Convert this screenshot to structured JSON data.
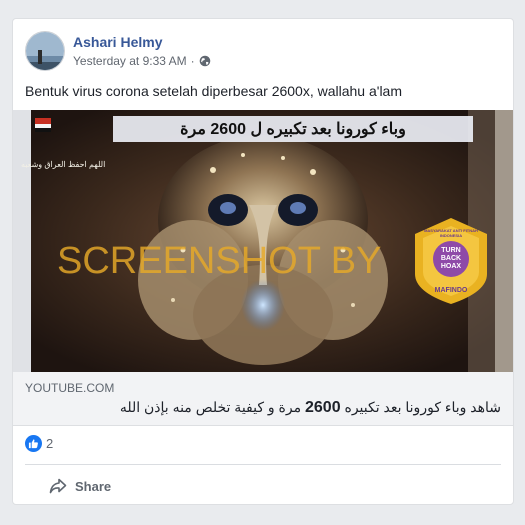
{
  "post": {
    "author": "Ashari Helmy",
    "timestamp": "Yesterday at 9:33 AM",
    "separator": "·",
    "privacy_icon": "globe-icon",
    "text": "Bentuk virus corona setelah diperbesar 2600x, wallahu a'lam"
  },
  "media": {
    "banner_text": "وباء كورونا بعد تكبيره ل 2600 مرة",
    "side_caption": "اللهم احفظ العراق وشعبه",
    "watermark": "SCREENSHOT BY",
    "badge": {
      "ring_text": "MASYARAKAT ANTI FITNAH INDONESIA",
      "line1": "TURN",
      "line2": "BACK",
      "line3": "HOAX",
      "footer": "MAFINDO"
    }
  },
  "link": {
    "domain": "youtube.com",
    "title_before": "شاهد وباء كورونا بعد تكبيره ",
    "title_number": "2600",
    "title_after": " مرة و كيفية تخلص منه بإذن الله"
  },
  "reactions": {
    "icon": "like-icon",
    "count": "2"
  },
  "actions": {
    "share_label": "Share",
    "share_icon": "share-icon"
  },
  "colors": {
    "author": "#385898",
    "like": "#1877f2",
    "watermark": "#e6aa28",
    "badge_purple": "#8e4aa8",
    "badge_gold": "#e9b221"
  }
}
